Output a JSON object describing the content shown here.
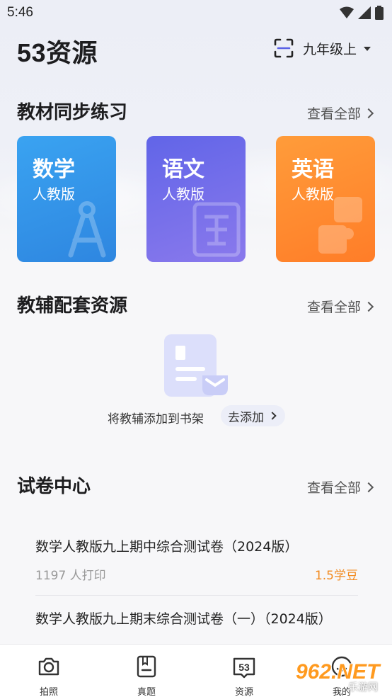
{
  "status": {
    "time": "5:46"
  },
  "header": {
    "app_title": "53资源",
    "grade": "九年级上"
  },
  "textbook_section": {
    "title": "教材同步练习",
    "view_all": "查看全部",
    "cards": [
      {
        "subject": "数学",
        "edition": "人教版",
        "color": "#3aa3f1"
      },
      {
        "subject": "语文",
        "edition": "人教版",
        "color": "#6a6de9"
      },
      {
        "subject": "英语",
        "edition": "人教版",
        "color": "#ff8e32"
      }
    ]
  },
  "aux_section": {
    "title": "教辅配套资源",
    "view_all": "查看全部",
    "empty_text": "将教辅添加到书架",
    "add_button": "去添加"
  },
  "exam_section": {
    "title": "试卷中心",
    "view_all": "查看全部",
    "items": [
      {
        "title": "数学人教版九上期中综合测试卷（2024版）",
        "count": "1197 人打印",
        "price": "1.5学豆"
      },
      {
        "title": "数学人教版九上期末综合测试卷（一）（2024版）",
        "count": "",
        "price": ""
      }
    ]
  },
  "bottom_nav": {
    "items": [
      {
        "label": "拍照",
        "icon": "camera-icon"
      },
      {
        "label": "真题",
        "icon": "book-icon"
      },
      {
        "label": "资源",
        "icon": "53-resource-icon"
      },
      {
        "label": "我的",
        "icon": "profile-icon"
      }
    ]
  },
  "watermark": {
    "text": "962.NET",
    "sub": "乐游网"
  }
}
